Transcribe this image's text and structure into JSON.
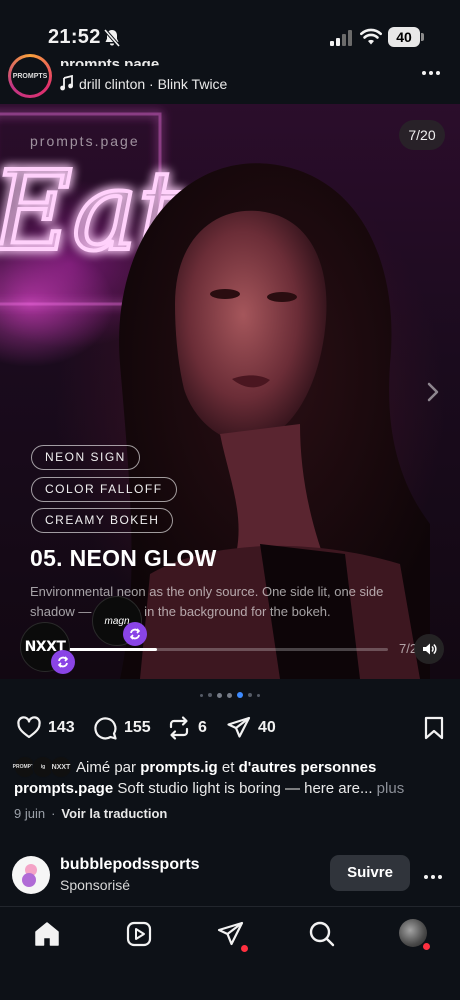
{
  "status_bar": {
    "time": "21:52",
    "battery": "40",
    "icons": [
      "bell-off-icon",
      "signal-icon",
      "wifi-icon",
      "battery-icon"
    ]
  },
  "post": {
    "username": "prompts.page",
    "avatar_text": "PROMPTS",
    "music": "drill clinton · Blink Twice",
    "more_icon": "more-horizontal-icon"
  },
  "media": {
    "watermark": "prompts.page",
    "counter": "7/20",
    "neon_sign": "Eat",
    "tags": [
      "NEON SIGN",
      "COLOR FALLOFF",
      "CREAMY BOKEH"
    ],
    "title": "05. NEON GLOW",
    "body": "Environmental neon as the only source. One side lit, one side shadow — the sign in the background for the bokeh.",
    "progress": 0.29,
    "time_label": "7/2",
    "collaborators": [
      "NXXT",
      "magn"
    ],
    "colors": {
      "neon": "#ff5be9",
      "badge": "#8a44e6"
    }
  },
  "carousel": {
    "count": 7,
    "active_index": 3
  },
  "actions": {
    "likes": "143",
    "comments": "155",
    "reposts": "6",
    "shares": "40"
  },
  "liked_by": {
    "prefix": "Aimé par",
    "user": "prompts.ig",
    "joiner": "et",
    "others": "d'autres personnes",
    "avatars": [
      "PROMPTS",
      "ig",
      "NXXT"
    ]
  },
  "caption": {
    "username": "prompts.page",
    "text": "Soft studio light is boring — here are...",
    "more": "plus"
  },
  "meta": {
    "date": "9 juin",
    "separator": "·",
    "translate": "Voir la traduction"
  },
  "sponsored": {
    "name": "bubblepodssports",
    "label": "Sponsorisé",
    "follow": "Suivre"
  },
  "nav": {
    "items": [
      "home-icon",
      "reels-icon",
      "direct-icon",
      "search-icon",
      "profile-avatar"
    ],
    "accent": "#ff3040"
  }
}
